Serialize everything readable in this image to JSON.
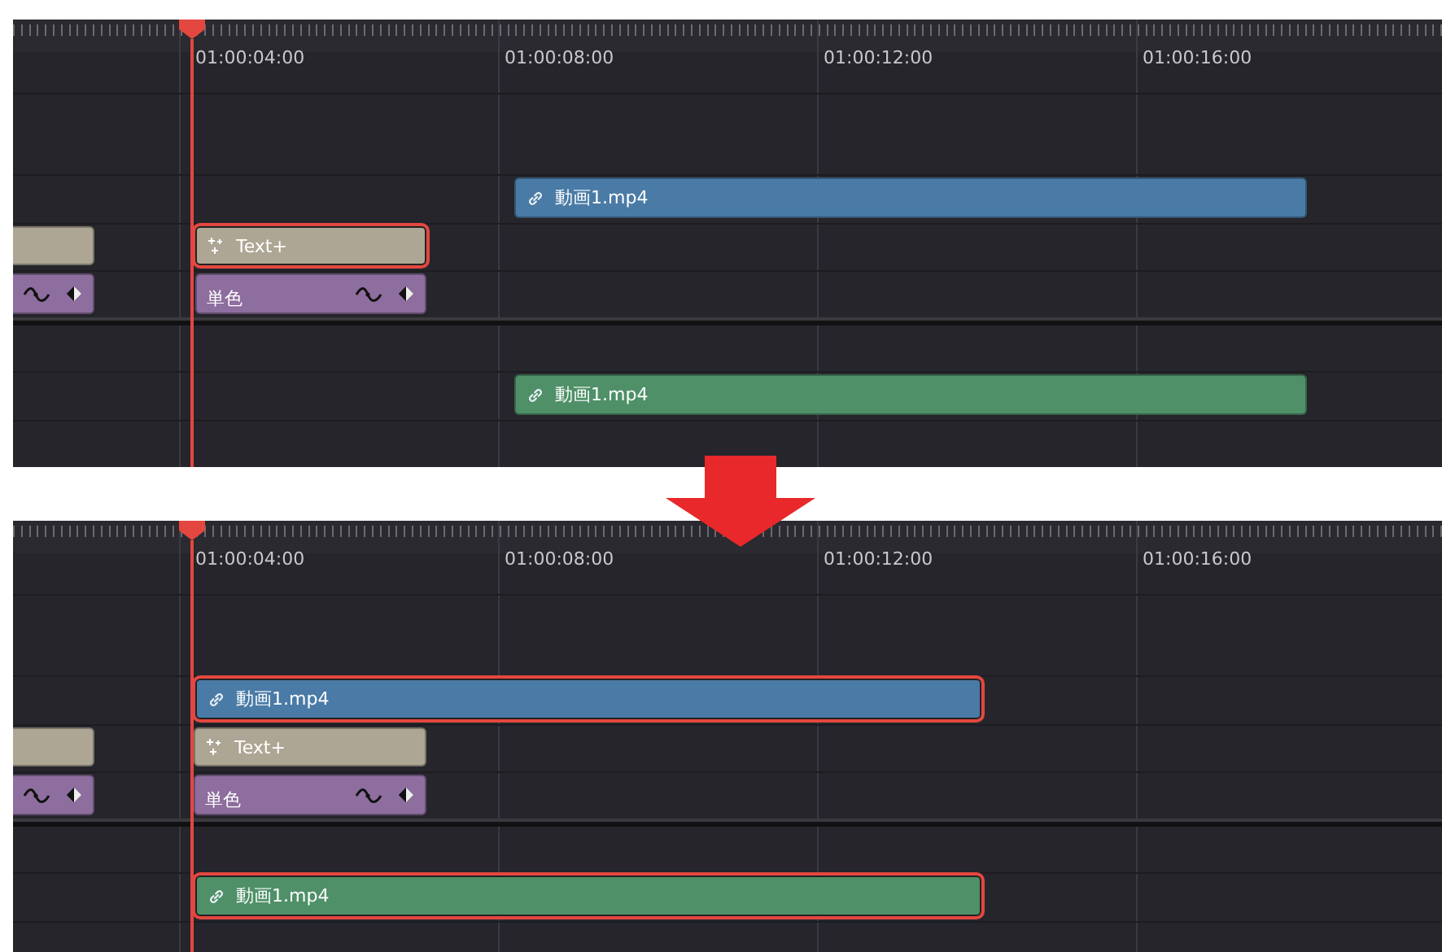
{
  "panels": [
    {
      "ruler": [
        "01:00:04:00",
        "01:00:08:00",
        "01:00:12:00",
        "01:00:16:00"
      ],
      "clips": [
        {
          "kind": "video",
          "label": "動画1.mp4",
          "color": "#4a7ba6",
          "selected": false
        },
        {
          "kind": "text",
          "color": "#aea694",
          "selected": false
        },
        {
          "kind": "text",
          "label": "Text+",
          "color": "#aea694",
          "selected": true
        },
        {
          "kind": "generator",
          "color": "#8e6e9e",
          "selected": false
        },
        {
          "kind": "generator",
          "label": "単色",
          "color": "#8e6e9e",
          "selected": false
        },
        {
          "kind": "video",
          "label": "動画1.mp4",
          "color": "#4f9068",
          "selected": false
        }
      ]
    },
    {
      "ruler": [
        "01:00:04:00",
        "01:00:08:00",
        "01:00:12:00",
        "01:00:16:00"
      ],
      "clips": [
        {
          "kind": "video",
          "label": "動画1.mp4",
          "color": "#4a7ba6",
          "selected": true
        },
        {
          "kind": "text",
          "color": "#aea694",
          "selected": false
        },
        {
          "kind": "text",
          "label": "Text+",
          "color": "#aea694",
          "selected": false
        },
        {
          "kind": "generator",
          "color": "#8e6e9e",
          "selected": false
        },
        {
          "kind": "generator",
          "label": "単色",
          "color": "#8e6e9e",
          "selected": false
        },
        {
          "kind": "video",
          "label": "動画1.mp4",
          "color": "#4f9068",
          "selected": true
        }
      ]
    }
  ]
}
